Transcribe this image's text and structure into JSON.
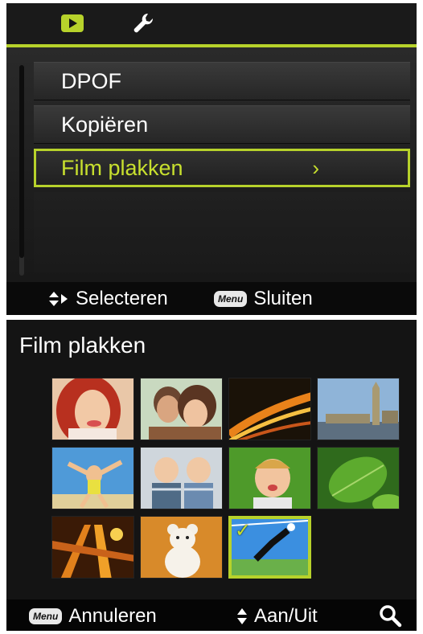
{
  "top_screen": {
    "tabs": [
      {
        "icon": "playback-icon",
        "active": true
      },
      {
        "icon": "wrench-icon",
        "active": false
      }
    ],
    "menu_items": [
      {
        "label": "DPOF"
      },
      {
        "label": "Kopiëren"
      },
      {
        "label": "Film plakken",
        "selected": true,
        "submenu_glyph": "›"
      }
    ],
    "help": {
      "select_label": "Selecteren",
      "menu_key": "Menu",
      "close_label": "Sluiten"
    }
  },
  "bottom_screen": {
    "title": "Film plakken",
    "thumbnails": [
      {
        "subject": "woman-portrait"
      },
      {
        "subject": "couple-portrait"
      },
      {
        "subject": "night-traffic"
      },
      {
        "subject": "city-skyline"
      },
      {
        "subject": "beach-jump"
      },
      {
        "subject": "two-children"
      },
      {
        "subject": "toddler-on-grass"
      },
      {
        "subject": "green-leaves"
      },
      {
        "subject": "amusement-ride"
      },
      {
        "subject": "teddy-bear"
      },
      {
        "subject": "soccer-goalkeeper",
        "checked": true
      }
    ],
    "footer": {
      "menu_key": "Menu",
      "cancel_label": "Annuleren",
      "toggle_label": "Aan/Uit"
    }
  },
  "colors": {
    "accent": "#b7d22b",
    "background": "#141414"
  }
}
